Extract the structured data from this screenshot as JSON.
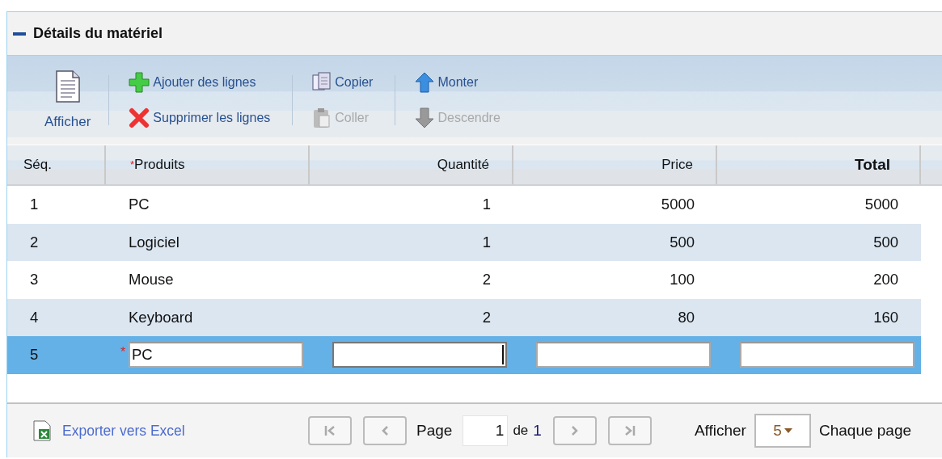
{
  "panel": {
    "title": "Détails du matériel",
    "expanded": true
  },
  "toolbar": {
    "view_button": {
      "label": "Afficher"
    },
    "groups": [
      {
        "buttons": [
          {
            "kind": "add",
            "label": "Ajouter des lignes",
            "disabled": false
          },
          {
            "kind": "delete",
            "label": "Supprimer les lignes",
            "disabled": false
          }
        ]
      },
      {
        "buttons": [
          {
            "kind": "copy",
            "label": "Copier",
            "disabled": false
          },
          {
            "kind": "paste",
            "label": "Coller",
            "disabled": true
          }
        ]
      },
      {
        "buttons": [
          {
            "kind": "up",
            "label": "Monter",
            "disabled": false
          },
          {
            "kind": "down",
            "label": "Descendre",
            "disabled": true
          }
        ]
      }
    ]
  },
  "table": {
    "columns": [
      {
        "label": "Séq.",
        "kind": "text",
        "bold": false
      },
      {
        "label": "Produits",
        "required_mark": "*",
        "kind": "text",
        "bold": false
      },
      {
        "label": "Quantité",
        "kind": "number",
        "bold": false
      },
      {
        "label": "Price",
        "kind": "number",
        "bold": false
      },
      {
        "label": "Total",
        "kind": "number",
        "bold": true
      }
    ],
    "rows": [
      {
        "kind": "data",
        "selected": false,
        "cells": [
          "1",
          "PC",
          "1",
          "5000",
          "5000"
        ]
      },
      {
        "kind": "data",
        "selected": false,
        "cells": [
          "2",
          "Logiciel",
          "1",
          "500",
          "500"
        ]
      },
      {
        "kind": "data",
        "selected": false,
        "cells": [
          "3",
          "Mouse",
          "2",
          "100",
          "200"
        ]
      },
      {
        "kind": "data",
        "selected": false,
        "cells": [
          "4",
          "Keyboard",
          "2",
          "80",
          "160"
        ]
      },
      {
        "kind": "edit",
        "selected": true,
        "seq": "5",
        "fields": [
          {
            "value": "PC",
            "required_mark": "*",
            "focused": false
          },
          {
            "focused": true
          },
          {
            "focused": false
          },
          {
            "focused": false
          }
        ]
      }
    ]
  },
  "footer": {
    "export_link": "Exporter vers Excel",
    "pager": {
      "first": {
        "disabled": true
      },
      "previous": {
        "disabled": true
      },
      "page_label": "Page",
      "page_input": "1",
      "of_label": "de",
      "total_pages": "1",
      "next": {
        "disabled": true
      },
      "last": {
        "disabled": true
      }
    },
    "page_size_label": "Afficher",
    "page_size": "5",
    "page_size_suffix": "Chaque page"
  }
}
